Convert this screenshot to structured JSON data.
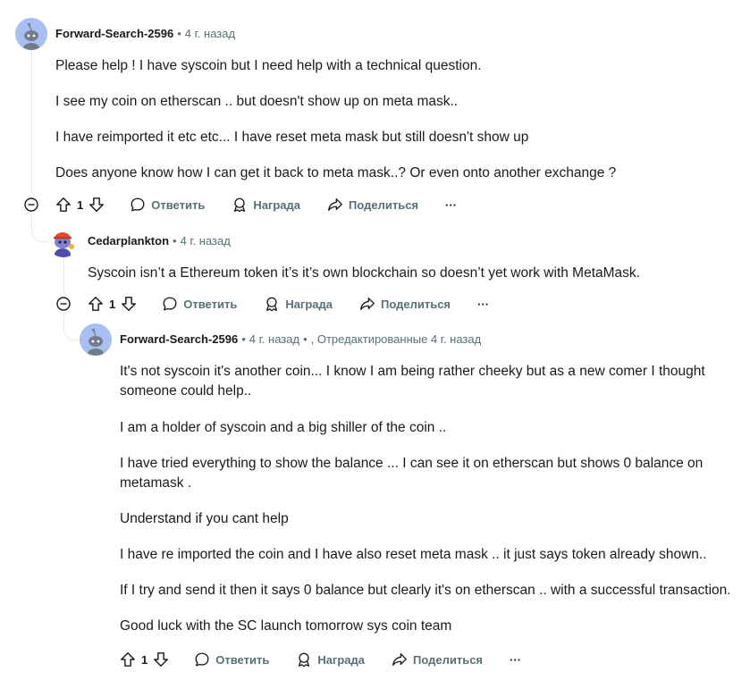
{
  "comments": [
    {
      "author": "Forward-Search-2596",
      "time": "4 г. назад",
      "edited": "",
      "paragraphs": [
        "Please help ! I have syscoin but I need help with a technical question.",
        "I see my coin on etherscan .. but doesn't show up on meta mask..",
        "I have reimported it etc etc... I have reset meta mask but still doesn't show up",
        "Does anyone know how I can get it back to meta mask..? Or even onto another exchange ?"
      ],
      "votes": "1"
    },
    {
      "author": "Cedarplankton",
      "time": "4 г. назад",
      "edited": "",
      "paragraphs": [
        "Syscoin isn’t a Ethereum token it’s it’s own blockchain so doesn’t yet work with MetaMask."
      ],
      "votes": "1"
    },
    {
      "author": "Forward-Search-2596",
      "time": "4 г. назад",
      "edited": ", Отредактированные 4 г. назад",
      "paragraphs": [
        "It's not syscoin it's another coin... I know I am being rather cheeky but as a new comer I thought someone could help..",
        "I am a holder of syscoin and a big shiller of the coin ..",
        "I have tried everything to show the balance ... I can see it on etherscan but shows 0 balance on metamask .",
        "Understand if you cant help",
        "I have re imported the coin and I have also reset meta mask .. it just says token already shown..",
        "If I try and send it then it says 0 balance but clearly it's on etherscan .. with a successful transaction.",
        "Good luck with the SC launch tomorrow sys coin team"
      ],
      "votes": "1"
    }
  ],
  "labels": {
    "reply": "Ответить",
    "award": "Награда",
    "share": "Поделиться",
    "more": "···",
    "dot": "•"
  },
  "icons": {
    "upvote": "arrow-up-icon",
    "downvote": "arrow-down-icon",
    "reply": "speech-bubble-icon",
    "award": "award-icon",
    "share": "share-arrow-icon",
    "collapse": "minus-circle-icon"
  },
  "colors": {
    "meta": "#576f76",
    "text": "#1a1a1b",
    "avatar_bg": "#a8bff2",
    "thread_line": "#e5ebee"
  }
}
